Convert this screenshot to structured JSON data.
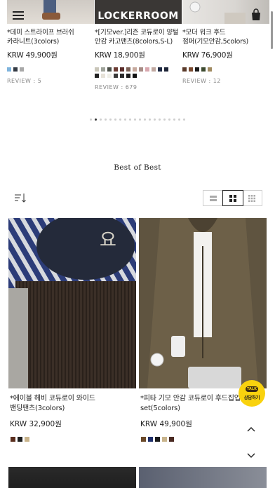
{
  "header": {
    "menu_icon": "hamburger-icon",
    "logo": "LOCKERROOM",
    "cart_icon": "shopping-bag-icon"
  },
  "carousel": {
    "items": [
      {
        "name_line1": "*데미 스트라이프 브러쉬",
        "name_line2": "카라니트(3colors)",
        "price": "KRW 49,900원",
        "swatches": [
          "#7fb4dd",
          "#333a44",
          "#a8a8a8"
        ],
        "review": "REVIEW : 5"
      },
      {
        "name_line1": "*[기모ver.]리즌 코듀로이 양털",
        "name_line2": "안감 카고팬츠(8colors,S-L)",
        "price": "KRW 18,900원",
        "swatches": [
          "#c9c6b9",
          "#9fa39a",
          "#4b4f47",
          "#6b3b33",
          "#5a2d2a",
          "#7b6055",
          "#c6a89c",
          "#a88c86",
          "#d8a7ae",
          "#c0a8a0",
          "#1f2a44",
          "#1c2336",
          "#222222",
          "#e6e2d8",
          "#efeee7",
          "#3a3a3a",
          "#2b2b2b",
          "#1b1b1b",
          "#111111"
        ],
        "review": "REVIEW : 679"
      },
      {
        "name_line1": "*모더 워크 후드",
        "name_line2": "점퍼(기모안감,5colors)",
        "price": "KRW 76,900원",
        "swatches": [
          "#5a3a2a",
          "#7a4a30",
          "#1a1a1a",
          "#3d4a2f",
          "#a08a60"
        ],
        "review": "REVIEW : 12"
      }
    ],
    "dot_count": 20,
    "active_dot": 1
  },
  "section": {
    "title": "Best of Best",
    "sort_icon": "sort-descending-icon",
    "view_modes": [
      "list-view-icon",
      "grid-2-icon",
      "grid-3-icon"
    ],
    "active_view": 1
  },
  "products": [
    {
      "name_line1": "*에이블 헤비 코듀로이 와이드",
      "name_line2": "밴딩팬츠(3colors)",
      "price": "KRW 32,900원",
      "swatches": [
        "#5a2e1e",
        "#1e1e1e",
        "#c9b48c"
      ]
    },
    {
      "name_line1": "*피타 기모 안감 코듀로이 후드집업",
      "name_line2": "set(5colors)",
      "price": "KRW 49,900원",
      "swatches": [
        "#6b4a2a",
        "#1f2f6a",
        "#1a1a1a",
        "#c9b48c",
        "#4a2a22"
      ]
    }
  ],
  "floating": {
    "talk_badge": "TALK",
    "talk_label": "상담하기",
    "scroll_up_icon": "chevron-up-icon",
    "scroll_down_icon": "chevron-down-icon"
  }
}
